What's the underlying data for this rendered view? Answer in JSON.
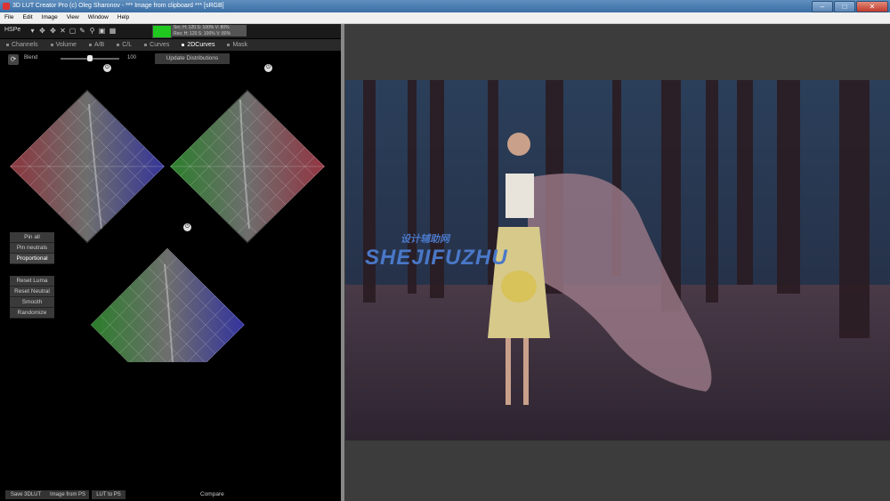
{
  "window": {
    "title": "3D LUT Creator Pro (c) Oleg Sharonov - *** Image from clipboard *** [sRGB]"
  },
  "menu": [
    "File",
    "Edit",
    "Image",
    "View",
    "Window",
    "Help"
  ],
  "toolbar": {
    "mode": "HSPe",
    "readout_line1": "Src: H: 120   S: 100% V: 80%",
    "readout_line2": "Res: H: 120   S: 100% V: 80%",
    "swatch_color": "#1fc71f"
  },
  "tabs": [
    {
      "label": "Channels"
    },
    {
      "label": "Volume"
    },
    {
      "label": "A/B"
    },
    {
      "label": "C/L"
    },
    {
      "label": "Curves"
    },
    {
      "label": "2DCurves",
      "active": true
    },
    {
      "label": "Mask"
    }
  ],
  "blend": {
    "label": "Blend",
    "value": "100",
    "level": 1.0
  },
  "update_button": "Update Distributions",
  "side_buttons": {
    "pin_all": "Pin all",
    "pin_neutrals": "Pin neutrals",
    "proportional": "Proportional",
    "reset_luma": "Reset Luma",
    "reset_neutral": "Reset Neutral",
    "smooth": "Smooth",
    "randomize": "Randomize"
  },
  "bottom_buttons": {
    "save": "Save 3DLUT",
    "image_from_ps": "Image from PS",
    "lut_to_ps": "LUT to PS",
    "compare": "Compare"
  },
  "watermark": {
    "cn": "设计辅助网",
    "en": "SHEJIFUZHU"
  },
  "colors": {
    "red": "#a0404a",
    "green": "#3c8c3c",
    "blue": "#3a3ab0"
  }
}
